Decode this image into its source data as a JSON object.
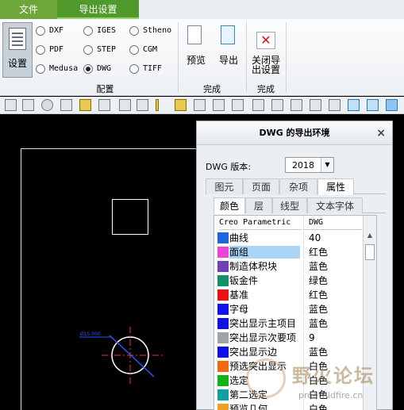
{
  "tabs": {
    "file": "文件",
    "export_settings": "导出设置"
  },
  "ribbon": {
    "setup": "设置",
    "formats": [
      {
        "label": "DXF",
        "selected": false
      },
      {
        "label": "IGES",
        "selected": false
      },
      {
        "label": "Stheno",
        "selected": false
      },
      {
        "label": "PDF",
        "selected": false
      },
      {
        "label": "STEP",
        "selected": false
      },
      {
        "label": "CGM",
        "selected": false
      },
      {
        "label": "Medusa",
        "selected": false
      },
      {
        "label": "DWG",
        "selected": true
      },
      {
        "label": "TIFF",
        "selected": false
      }
    ],
    "config_group": "配置",
    "preview": "预览",
    "export": "导出",
    "finish_group": "完成",
    "close_line1": "关闭导",
    "close_line2": "出设置",
    "finish_group2": "完成"
  },
  "dialog": {
    "title": "DWG 的导出环境",
    "close": "×",
    "version_label": "DWG 版本:",
    "version_value": "2018",
    "tabs": [
      "图元",
      "页面",
      "杂项",
      "属性"
    ],
    "active_tab": "属性",
    "subtabs": [
      "颜色",
      "层",
      "线型",
      "文本字体"
    ],
    "active_subtab": "颜色",
    "table": {
      "headers": [
        "Creo Parametric",
        "DWG"
      ],
      "rows": [
        {
          "name": "曲线",
          "value": "40",
          "color": "#1f64e0"
        },
        {
          "name": "面组",
          "value": "红色",
          "color": "#f044d8",
          "selected": true
        },
        {
          "name": "制造体积块",
          "value": "蓝色",
          "color": "#7040b8"
        },
        {
          "name": "钣金件",
          "value": "绿色",
          "color": "#12906a"
        },
        {
          "name": "基准",
          "value": "红色",
          "color": "#ee1010"
        },
        {
          "name": "字母",
          "value": "蓝色",
          "color": "#1212f0"
        },
        {
          "name": "突出显示主项目",
          "value": "蓝色",
          "color": "#1212e0"
        },
        {
          "name": "突出显示次要项",
          "value": "9",
          "color": "#a0a4aa"
        },
        {
          "name": "突出显示边",
          "value": "蓝色",
          "color": "#1010e8"
        },
        {
          "name": "预选突出显示",
          "value": "白色",
          "color": "#f26a10"
        },
        {
          "name": "选定",
          "value": "白色",
          "color": "#10b410"
        },
        {
          "name": "第二选定",
          "value": "白色",
          "color": "#10a0a0"
        },
        {
          "name": "预览几何",
          "value": "白色",
          "color": "#f0a020"
        }
      ]
    }
  },
  "canvas": {
    "annotation": "Ø15.000"
  },
  "watermark": {
    "text": "野火论坛",
    "url": "proewildfire.cn"
  }
}
